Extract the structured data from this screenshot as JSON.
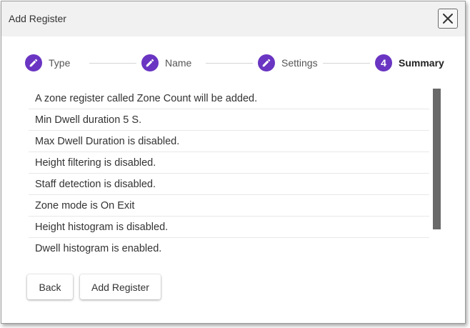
{
  "dialog": {
    "title": "Add Register",
    "close_icon": "close-icon"
  },
  "stepper": {
    "steps": [
      {
        "label": "Type",
        "icon": "pencil-icon",
        "state": "completed"
      },
      {
        "label": "Name",
        "icon": "pencil-icon",
        "state": "completed"
      },
      {
        "label": "Settings",
        "icon": "pencil-icon",
        "state": "completed"
      },
      {
        "label": "Summary",
        "number": "4",
        "state": "active"
      }
    ],
    "accent_color": "#6a35c2"
  },
  "summary": {
    "items": [
      "A zone register called Zone Count will be added.",
      "Min Dwell duration 5 S.",
      "Max Dwell Duration is disabled.",
      "Height filtering is disabled.",
      "Staff detection is disabled.",
      "Zone mode is On Exit",
      "Height histogram is disabled.",
      "Dwell histogram is enabled."
    ]
  },
  "buttons": {
    "back_label": "Back",
    "add_register_label": "Add Register"
  }
}
